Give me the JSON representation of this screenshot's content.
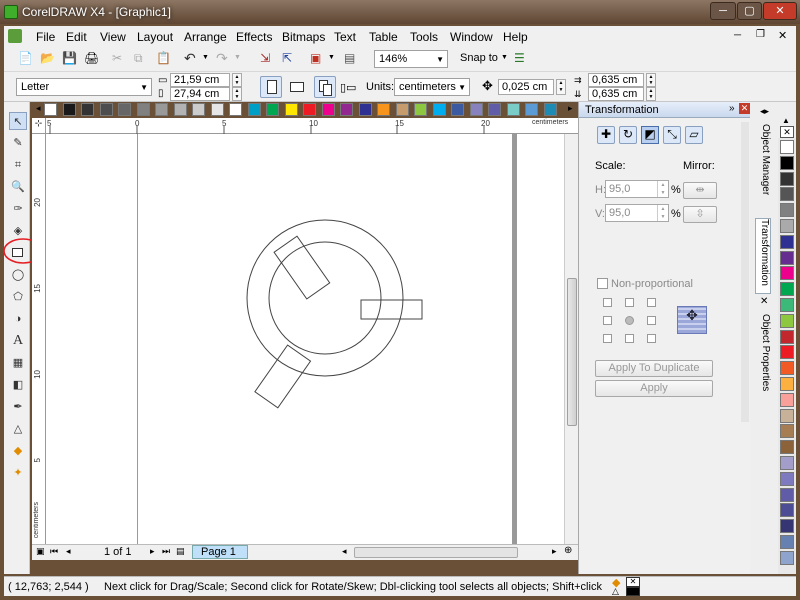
{
  "window": {
    "title": "CorelDRAW X4 - [Graphic1]"
  },
  "menu": [
    "File",
    "Edit",
    "View",
    "Layout",
    "Arrange",
    "Effects",
    "Bitmaps",
    "Text",
    "Table",
    "Tools",
    "Window",
    "Help"
  ],
  "toolbar": {
    "zoom": "146%",
    "snap_label": "Snap to"
  },
  "property_bar": {
    "page_size": "Letter",
    "width": "21,59 cm",
    "height": "27,94 cm",
    "units_label": "Units:",
    "units": "centimeters",
    "nudge": "0,025 cm",
    "dup_x": "0,635 cm",
    "dup_y": "0,635 cm"
  },
  "rulers": {
    "h_labels": [
      "5",
      "0",
      "5",
      "10",
      "15",
      "20"
    ],
    "h_unit": "centimeters",
    "v_labels": [
      "20",
      "15",
      "10",
      "5"
    ],
    "v_unit": "centimeters"
  },
  "page_nav": {
    "count": "1 of 1",
    "tab": "Page 1"
  },
  "docker": {
    "title": "Transformation",
    "scale_label": "Scale:",
    "mirror_label": "Mirror:",
    "h_label": "H:",
    "h_value": "95,0",
    "v_label": "V:",
    "v_value": "95,0",
    "pct": "%",
    "nonprop": "Non-proportional",
    "apply_dup": "Apply To Duplicate",
    "apply": "Apply"
  },
  "side_tabs": [
    "Object Manager",
    "Transformation",
    "Object Properties"
  ],
  "status": {
    "coords": "( 12,763; 2,544 )",
    "hint": "Next click for Drag/Scale; Second click for Rotate/Skew; Dbl-clicking tool selects all objects; Shift+click multi-selects; Alt+cli..."
  },
  "palette": [
    "#ffffff",
    "#1a1a1a",
    "#333333",
    "#4d4d4d",
    "#666666",
    "#808080",
    "#999999",
    "#b3b3b3",
    "#cccccc",
    "#e6e6e6",
    "#ffffff",
    "#00a0c6",
    "#00a650",
    "#ffe600",
    "#ed1c24",
    "#ec008c",
    "#92278f",
    "#2e3192",
    "#f7941d",
    "#c69c6d",
    "#8dc63f",
    "#00aeef",
    "#3c5aa0",
    "#8781bd",
    "#605ca8",
    "#7accc8",
    "#5a9bd5",
    "#1d8bb3"
  ],
  "right_palette": [
    "#ffffff",
    "#000000",
    "#333333",
    "#555555",
    "#808080",
    "#aaaaaa",
    "#2e3192",
    "#662d91",
    "#ec008c",
    "#00a650",
    "#3cb878",
    "#8dc63f",
    "#c1272d",
    "#ed1c24",
    "#f15a24",
    "#fbb040",
    "#f9a09b",
    "#c7b299",
    "#a67c52",
    "#8c6239",
    "#a39dc9",
    "#7e7abf",
    "#605ca8",
    "#4d4d96",
    "#353573",
    "#6680b2",
    "#8fa4cc"
  ],
  "accent": "#e31e24"
}
